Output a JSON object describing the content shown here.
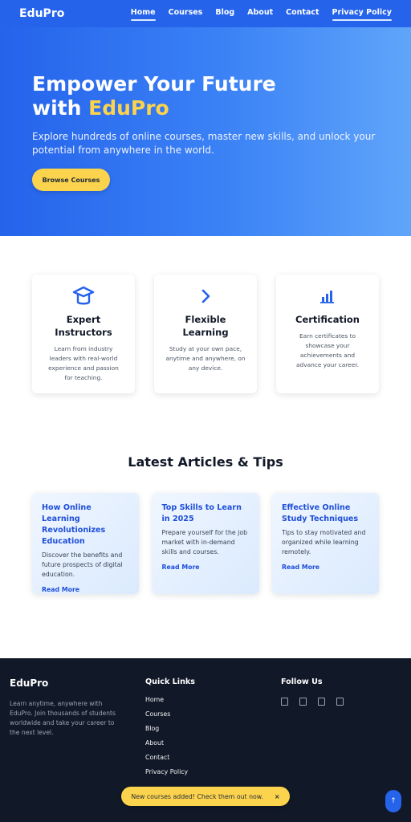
{
  "nav": {
    "brand": "EduPro",
    "links": [
      "Home",
      "Courses",
      "Blog",
      "About",
      "Contact",
      "Privacy Policy"
    ]
  },
  "hero": {
    "title_line1": "Empower Your Future",
    "title_with": "with ",
    "title_highlight": "EduPro",
    "subtitle": "Explore hundreds of online courses, master new skills, and unlock your potential from anywhere in the world.",
    "cta": "Browse Courses"
  },
  "features": [
    {
      "icon": "graduation-cap-icon",
      "title": "Expert Instructors",
      "text": "Learn from industry leaders with real-world experience and passion for teaching."
    },
    {
      "icon": "chevron-right-icon",
      "title": "Flexible Learning",
      "text": "Study at your own pace, anytime and anywhere, on any device."
    },
    {
      "icon": "bar-chart-icon",
      "title": "Certification",
      "text": "Earn certificates to showcase your achievements and advance your career."
    }
  ],
  "articles": {
    "heading": "Latest Articles & Tips",
    "items": [
      {
        "title": "How Online Learning Revolutionizes Education",
        "text": "Discover the benefits and future prospects of digital education.",
        "link": "Read More"
      },
      {
        "title": "Top Skills to Learn in 2025",
        "text": "Prepare yourself for the job market with in-demand skills and courses.",
        "link": "Read More"
      },
      {
        "title": "Effective Online Study Techniques",
        "text": "Tips to stay motivated and organized while learning remotely.",
        "link": "Read More"
      }
    ]
  },
  "footer": {
    "brand": "EduPro",
    "description": "Learn anytime, anywhere with EduPro. Join thousands of students worldwide and take your career to the next level.",
    "quick_links_title": "Quick Links",
    "quick_links": [
      "Home",
      "Courses",
      "Blog",
      "About",
      "Contact",
      "Privacy Policy"
    ],
    "follow_title": "Follow Us",
    "social_icons": [
      "facebook-icon",
      "twitter-icon",
      "instagram-icon",
      "linkedin-icon"
    ]
  },
  "toast": {
    "message": "New courses added! Check them out now.",
    "close": "×"
  },
  "scroll_top": {
    "label": "↑"
  },
  "colors": {
    "primary": "#2563eb",
    "accent": "#fcd34d",
    "footer_bg": "#111827"
  }
}
